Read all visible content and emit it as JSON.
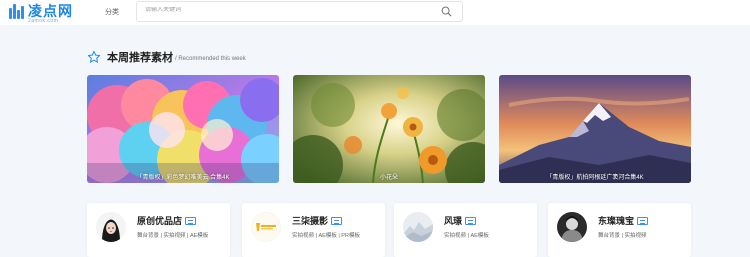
{
  "header": {
    "logo_main": "凌点网",
    "logo_sub": "2amok.com",
    "category_label": "分类",
    "search_placeholder": "请输入关键词"
  },
  "section": {
    "title": "本周推荐素材",
    "subtitle": "/ Recommended this week"
  },
  "banners": [
    {
      "caption": "「青版权」彩色梦幻唯美云 合集4K"
    },
    {
      "caption": "小花朵"
    },
    {
      "caption": "「青版权」航拍阿根廷广袤河合集4K"
    }
  ],
  "shops": [
    {
      "name": "原创优品店",
      "tags": "舞台背景 | 实拍视频 | AE模板"
    },
    {
      "name": "三柒摄影",
      "tags": "实拍视频 | AE模板 | PR模板"
    },
    {
      "name": "风璟",
      "tags": "实拍视频 | AE模板"
    },
    {
      "name": "东璨瑰宝",
      "tags": "舞台背景 | 实拍视频"
    }
  ],
  "colors": {
    "brand": "#1a86ec",
    "page_background": "#f3f6fa",
    "verified_badge": "#3d8ff0"
  }
}
